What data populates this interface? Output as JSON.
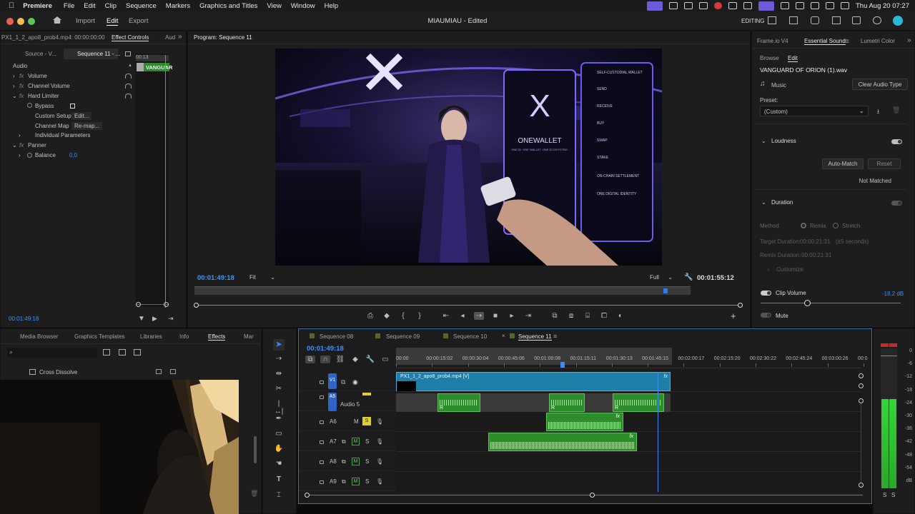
{
  "menubar": {
    "app": "Premiere",
    "items": [
      "File",
      "Edit",
      "Clip",
      "Sequence",
      "Markers",
      "Graphics and Titles",
      "View",
      "Window",
      "Help"
    ],
    "clock": "Thu Aug 20  07:27"
  },
  "titlebar": {
    "tabs": [
      "Import",
      "Edit",
      "Export"
    ],
    "title": "MIAUMIAU - Edited",
    "workspace": "EDITING"
  },
  "effect_controls": {
    "tabs": [
      "PX1_1_2_apo8_prob4.mp4: 00:00:00:00",
      "Effect Controls",
      "Aud"
    ],
    "source_tab": "Source - V...",
    "seq_tab": "Sequence 11 - ...",
    "section": "Audio",
    "mini_time": "00:13",
    "clip_label": "VANGUAR",
    "rows": [
      {
        "label": "Volume"
      },
      {
        "label": "Channel Volume"
      },
      {
        "label": "Hard Limiter"
      },
      {
        "label": "Bypass"
      },
      {
        "label": "Custom Setup",
        "value": "Edit..."
      },
      {
        "label": "Channel Map",
        "value": "Re-map..."
      },
      {
        "label": "Individual Parameters"
      },
      {
        "label": "Panner"
      },
      {
        "label": "Balance",
        "value": "0,0"
      }
    ],
    "timecode": "00:01:49:18"
  },
  "program": {
    "title": "Program: Sequence 11",
    "timecode": "00:01:49:18",
    "fit": "Fit",
    "quality": "Full",
    "duration": "00:01:55:12",
    "image": {
      "big_logo": "X",
      "brand": "ONEWALLET",
      "tag": "ONE ID. ONE WALLET. ONE ECOSYSTEM.",
      "menu": [
        "SELF-CUSTODIAL WALLET",
        "SEND",
        "RECEIVE",
        "BUY",
        "SWAP",
        "STAKE",
        "ON-CHAIN SETTLEMENT",
        "ONE DIGITAL IDENTITY"
      ]
    }
  },
  "essential_sound": {
    "tabs": [
      "Frame.io V4",
      "Essential Sound",
      "Lumetri Color"
    ],
    "subtabs": [
      "Browse",
      "Edit"
    ],
    "clip_name": "VANGUARD OF ORION (1).wav",
    "type": "Music",
    "clear_button": "Clear Audio Type",
    "preset_label": "Preset:",
    "preset_value": "(Custom)",
    "loudness": {
      "label": "Loudness",
      "automatch": "Auto-Match",
      "reset": "Reset",
      "status": "Not Matched"
    },
    "duration": {
      "label": "Duration",
      "method_label": "Method",
      "remix": "Remix",
      "stretch": "Stretch",
      "target_label": "Target Duration:",
      "target": "00:00:21:31",
      "target_hint": "(±5 seconds)",
      "remix_label": "Remix Duration:",
      "remix_value": "00:00:21:31",
      "customize": "Customize"
    },
    "clip_volume": {
      "label": "Clip Volume",
      "value": "-18,2 dB",
      "level": 0.2
    },
    "mute": "Mute"
  },
  "effects": {
    "tabs": [
      "Media Browser",
      "Graphics Templates",
      "Libraries",
      "Info",
      "Effects",
      "Mar"
    ],
    "items": [
      "Cross Dissolve"
    ]
  },
  "timeline": {
    "tabs": [
      "Sequence 08",
      "Sequence 09",
      "Sequence 10",
      "Sequence 11"
    ],
    "timecode": "00:01:49:18",
    "ruler": [
      "00:00",
      "00:00:15:02",
      "00:00:30:04",
      "00:00:45:06",
      "00:01:00:08",
      "00:01:15:11",
      "00:01:30:13",
      "00:01:45:15",
      "00:02:00:17",
      "00:02:15:20",
      "00:02:30:22",
      "00:02:45:24",
      "00:03:00:26",
      "00:0"
    ],
    "tracks": [
      {
        "id": "V1"
      },
      {
        "id": "A5",
        "name": "Audio 5"
      },
      {
        "id": "A6"
      },
      {
        "id": "A7"
      },
      {
        "id": "A8"
      },
      {
        "id": "A9"
      }
    ],
    "video_clip": "PX1_1_2_apo8_prob4.mp4 [V]",
    "fx": "fx",
    "r": "R"
  },
  "meter": {
    "scale": [
      "0",
      "-6",
      "-12",
      "-18",
      "-24",
      "-30",
      "-36",
      "-42",
      "-48",
      "-54",
      "dB"
    ],
    "channels": [
      "S",
      "S"
    ]
  }
}
